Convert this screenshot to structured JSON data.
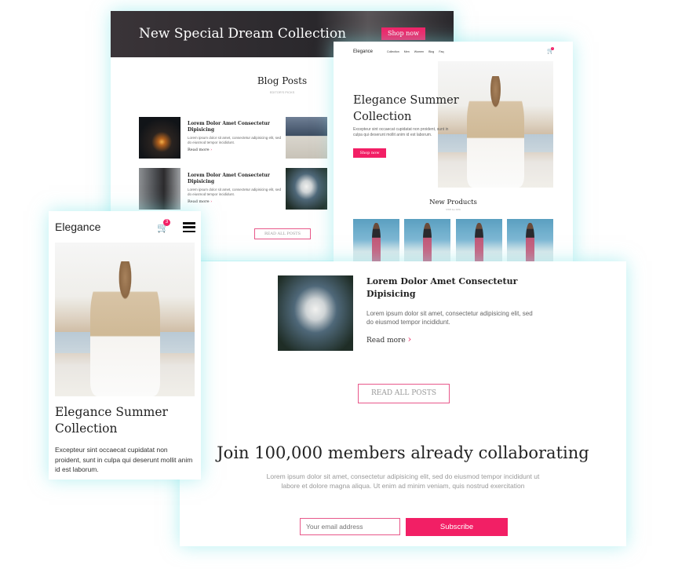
{
  "blog_page": {
    "hero_title": "New Special Dream Collection",
    "hero_button": "Shop now",
    "section_title": "Blog Posts",
    "section_sub": "EDITOR'S PICKS",
    "posts": [
      {
        "title": "Lorem Dolor Amet Consectetur Dipisicing",
        "body": "Lorem ipsum dolor sit amet, consectetur adipisicing elit, sed do eiusmod tempor incididunt.",
        "read_more": "Read more"
      },
      {
        "title": "Lorem Dolor Amet Consectetur Dipisicing",
        "body": "Lorem ipsum dolor sit amet, consectetur adipisicing elit, sed do eiusmod tempor incididunt.",
        "read_more": "Read more"
      }
    ],
    "read_all": "READ ALL POSTS"
  },
  "desktop_page": {
    "logo": "Elegance",
    "nav": [
      "Collection",
      "Men",
      "Women",
      "Blog",
      "Faq"
    ],
    "cart_count": "2",
    "hero_title": "Elegance Summer Collection",
    "hero_body": "Excepteur sint occaecat cupidatat non proident, sunt in culpa qui deserunt mollit anim id est laborum.",
    "hero_button": "Shop now",
    "products_title": "New Products",
    "products_sub": "SHOP ALL NOW"
  },
  "mobile_page": {
    "logo": "Elegance",
    "cart_count": "3",
    "hero_title": "Elegance Summer Collection",
    "hero_body": "Excepteur sint occaecat cupidatat non proident, sunt in culpa qui deserunt mollit anim id est laborum."
  },
  "front_page": {
    "post_title": "Lorem Dolor Amet Consectetur Dipisicing",
    "post_body": "Lorem ipsum dolor sit amet, consectetur adipisicing elit, sed do eiusmod tempor incididunt.",
    "read_more": "Read more",
    "read_all": "READ ALL POSTS",
    "join_title": "Join 100,000 members already collaborating",
    "join_body": "Lorem ipsum dolor sit amet, consectetur adipisicing elit, sed do eiusmod tempor incididunt ut labore et dolore magna aliqua. Ut enim ad minim veniam, quis nostrud exercitation",
    "email_placeholder": "Your email address",
    "subscribe": "Subscribe"
  },
  "colors": {
    "accent": "#f21f65",
    "dark_hero": "#2c2a2e",
    "glow": "#78e1e6"
  }
}
